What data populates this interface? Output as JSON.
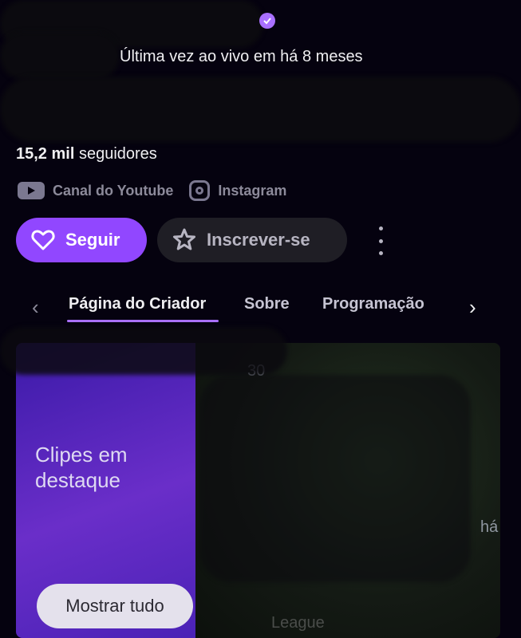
{
  "profile": {
    "last_live": "Última vez ao vivo em há 8 meses",
    "followers_count": "15,2 mil",
    "followers_label": "seguidores"
  },
  "links": [
    {
      "label": "Canal do Youtube",
      "icon": "youtube-icon"
    },
    {
      "label": "Instagram",
      "icon": "instagram-icon"
    }
  ],
  "actions": {
    "follow_label": "Seguir",
    "subscribe_label": "Inscrever-se"
  },
  "tabs": [
    {
      "label": "Página do Criador",
      "active": true
    },
    {
      "label": "Sobre",
      "active": false
    },
    {
      "label": "Programação",
      "active": false
    }
  ],
  "featured": {
    "title": "Clipes em destaque",
    "show_all": "Mostrar tudo",
    "thumb_duration": "30",
    "thumb_age": "há",
    "thumb_game": "League"
  },
  "colors": {
    "accent": "#9147ff",
    "background": "#05020f"
  }
}
